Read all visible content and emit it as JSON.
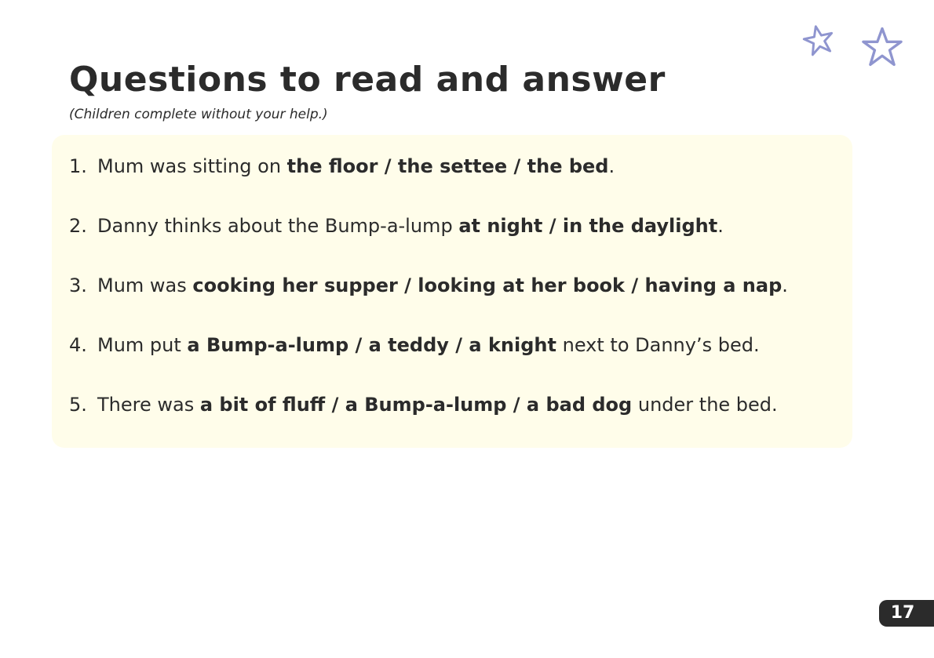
{
  "heading": {
    "title": "Questions to read and answer",
    "subtitle": "(Children complete without your help.)"
  },
  "questions": [
    {
      "number": "1.",
      "before": "Mum was sitting on ",
      "options": "the floor / the settee / the bed",
      "after": "."
    },
    {
      "number": "2.",
      "before": "Danny thinks about the Bump-a-lump ",
      "options": "at night / in the daylight",
      "after": "."
    },
    {
      "number": "3.",
      "before": "Mum was ",
      "options": "cooking her supper / looking at her book / having a nap",
      "after": "."
    },
    {
      "number": "4.",
      "before": "Mum put ",
      "options": "a Bump-a-lump / a teddy / a knight",
      "after": " next to Danny’s bed."
    },
    {
      "number": "5.",
      "before": "There was ",
      "options": "a bit of fluff / a Bump-a-lump / a bad dog",
      "after": " under the bed."
    }
  ],
  "decorations": {
    "star_icon": "star-outline-icon",
    "star_color": "#8f95cf"
  },
  "colors": {
    "panel_background": "#fffdea",
    "text": "#2b2b2b",
    "page_tab": "#2b2b2b"
  },
  "page_number": "17"
}
